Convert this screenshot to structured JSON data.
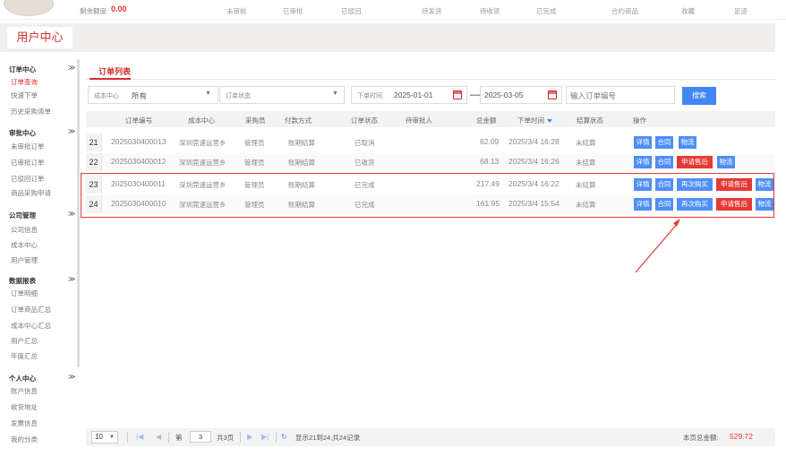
{
  "topbar": {
    "balance_label": "剩余额度:",
    "balance_value": "0.00",
    "stats": [
      "未审批",
      "已审批",
      "已驳回",
      "待发货",
      "待收货",
      "已完成",
      "合约商品",
      "收藏",
      "足迹"
    ]
  },
  "header": {
    "title": "用户中心"
  },
  "sidebar": {
    "groups": [
      {
        "title": "订单中心",
        "items": [
          "订单查询",
          "快速下单",
          "历史采购清单"
        ]
      },
      {
        "title": "审批中心",
        "items": [
          "未审批订单",
          "已审批订单",
          "已驳回订单",
          "商品采购申请"
        ]
      },
      {
        "title": "公司管理",
        "items": [
          "公司信息",
          "成本中心",
          "用户管理"
        ]
      },
      {
        "title": "数据报表",
        "items": [
          "订单明细",
          "订单商品汇总",
          "成本中心汇总",
          "用户汇总",
          "年度汇总"
        ]
      },
      {
        "title": "个人中心",
        "items": [
          "账户信息",
          "收货地址",
          "发票信息",
          "我的分类"
        ]
      }
    ],
    "chevron": "≫"
  },
  "main": {
    "tab_title": "订单列表",
    "filters": {
      "cost_center_label": "成本中心",
      "cost_center_value": "所有",
      "status_label": "订单状态",
      "status_value": "",
      "time_label": "下单时间",
      "date_from": "2025-01-01",
      "date_to": "2025-03-05",
      "date_sep": "—",
      "order_no_placeholder": "输入订单编号",
      "search_label": "搜索"
    },
    "columns": [
      "订单编号",
      "成本中心",
      "采购员",
      "付款方式",
      "订单状态",
      "待审批人",
      "总金额",
      "下单时间",
      "结算状态",
      "操作"
    ],
    "rows": [
      {
        "num": "21",
        "order_no": "2025030400013",
        "cost_center": "深圳莞速运营乡",
        "buyer": "管理员",
        "payment": "账期结算",
        "status": "已取消",
        "approver": "",
        "amount": "62.09",
        "time": "2025/3/4 16:28",
        "settle": "未结算",
        "actions": [
          "详情",
          "合同",
          "物流"
        ]
      },
      {
        "num": "22",
        "order_no": "2025030400012",
        "cost_center": "深圳莞速运营乡",
        "buyer": "管理员",
        "payment": "账期结算",
        "status": "已收货",
        "approver": "",
        "amount": "68.13",
        "time": "2025/3/4 16:26",
        "settle": "未结算",
        "actions": [
          "详情",
          "合同",
          "申请售后",
          "物流"
        ]
      },
      {
        "num": "23",
        "order_no": "2025030400011",
        "cost_center": "深圳莞速运营乡",
        "buyer": "管理员",
        "payment": "账期结算",
        "status": "已完成",
        "approver": "",
        "amount": "217.49",
        "time": "2025/3/4 16:22",
        "settle": "未结算",
        "actions": [
          "详情",
          "合同",
          "再次购买",
          "申请售后",
          "物流"
        ]
      },
      {
        "num": "24",
        "order_no": "2025030400010",
        "cost_center": "深圳莞速运营乡",
        "buyer": "管理员",
        "payment": "账期结算",
        "status": "已完成",
        "approver": "",
        "amount": "161.95",
        "time": "2025/3/4 15:54",
        "settle": "未结算",
        "actions": [
          "详情",
          "合同",
          "再次购买",
          "申请售后",
          "物流"
        ]
      }
    ]
  },
  "pager": {
    "page_size": "10",
    "page_prefix": "第",
    "page_value": "3",
    "page_suffix": "共3页",
    "summary": "显示21到24,共24记录",
    "total_label": "本页总金额:",
    "total_value": "529.72"
  },
  "colors": {
    "accent": "#d32f2f",
    "action_blue": "#4f8ef7",
    "action_red": "#e53935"
  }
}
